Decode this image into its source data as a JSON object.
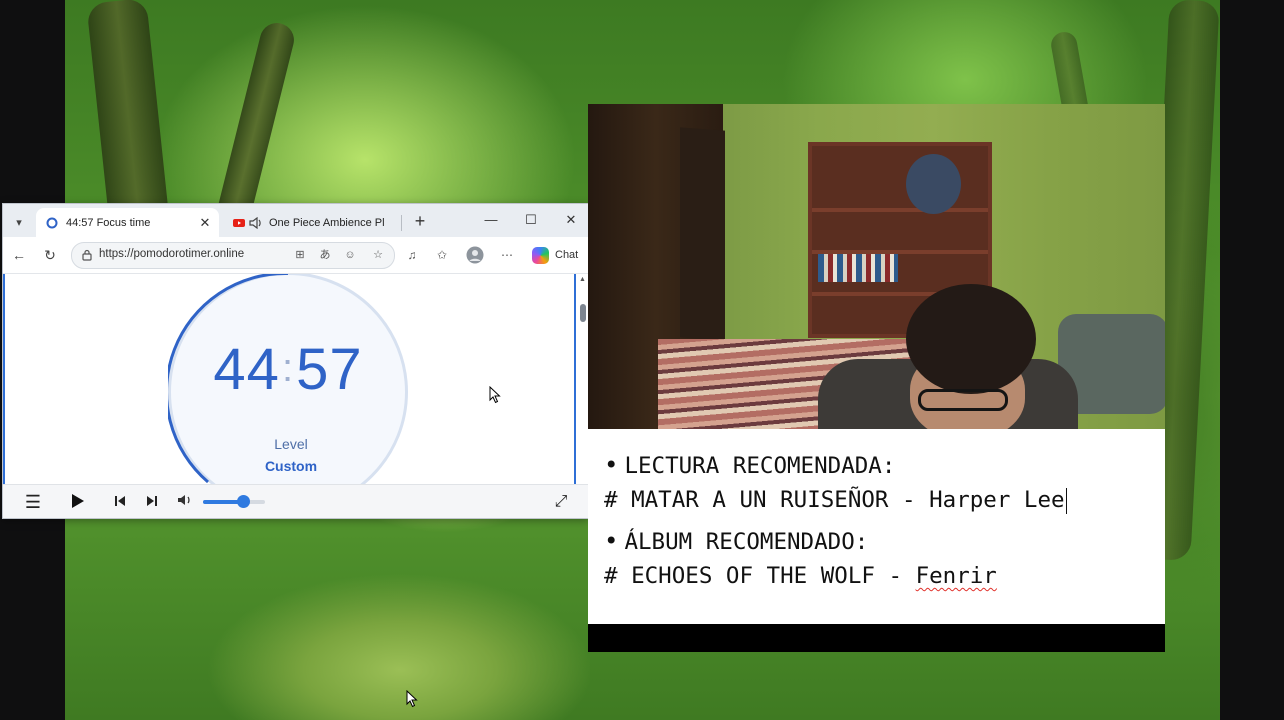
{
  "browser": {
    "tabs": [
      {
        "title": "44:57 Focus time",
        "active": true
      },
      {
        "title": "One Piece Ambience Pl",
        "active": false
      }
    ],
    "new_tab_symbol": "+",
    "window_controls": {
      "minimize": "—",
      "maximize": "☐",
      "close": "✕"
    },
    "url": "https://pomodorotimer.online",
    "chat_label": "Chat"
  },
  "timer": {
    "minutes": "44",
    "colon": ":",
    "seconds": "57",
    "level_label": "Level",
    "level_value": "Custom",
    "accent_color": "#2f63c7"
  },
  "player": {
    "volume_fraction": 0.65,
    "accent_color": "#2f7ae0"
  },
  "notes": {
    "line1": "LECTURA RECOMENDADA:",
    "line2": "# MATAR A UN RUISEÑOR - Harper Lee",
    "line3": "ÁLBUM RECOMENDADO:",
    "line4_prefix": "# ECHOES OF THE WOLF - ",
    "line4_word": "Fenrir",
    "bullet": "•"
  }
}
